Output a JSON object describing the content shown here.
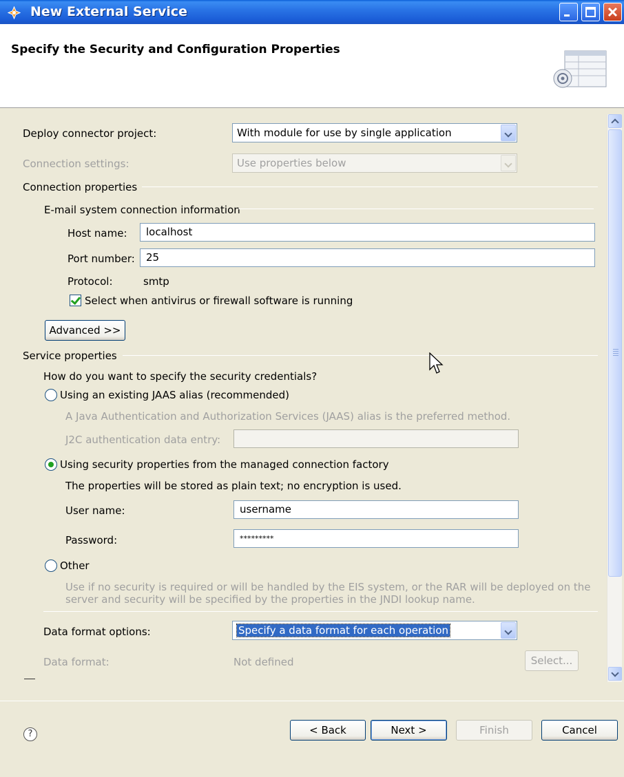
{
  "window": {
    "title": "New External Service"
  },
  "banner": {
    "title": "Specify the Security and Configuration Properties"
  },
  "deploy": {
    "label": "Deploy connector project:",
    "value": "With module for use by single application"
  },
  "connection_settings": {
    "label": "Connection settings:",
    "value": "Use properties below"
  },
  "connection_properties": {
    "title": "Connection properties",
    "email_group_title": "E-mail system connection information",
    "host_label": "Host name:",
    "host_value": "localhost",
    "port_label": "Port number:",
    "port_value": "25",
    "protocol_label": "Protocol:",
    "protocol_value": "smtp",
    "antivirus_label": "Select when antivirus or firewall software is running",
    "antivirus_checked": true,
    "advanced_button": "Advanced >>"
  },
  "service_properties": {
    "title": "Service properties",
    "question": "How do you want to specify the security credentials?",
    "jaas_option": "Using an existing JAAS alias (recommended)",
    "jaas_desc": "A Java Authentication and Authorization Services (JAAS) alias is the preferred method.",
    "j2c_label": "J2C authentication data entry:",
    "j2c_value": "",
    "mcf_option": "Using security properties from the managed connection factory",
    "mcf_desc": "The properties will be stored as plain text; no encryption is used.",
    "username_label": "User name:",
    "username_value": "username",
    "password_label": "Password:",
    "password_value": "*********",
    "other_option": "Other",
    "other_desc_line1": "Use if no security is required or will be handled by the EIS system, or the RAR will be deployed on the",
    "other_desc_line2": "server and security will be specified by the properties in the JNDI lookup name.",
    "selected_option": "mcf"
  },
  "data_format": {
    "options_label": "Data format options:",
    "options_value": "Specify a data format for each operation",
    "format_label": "Data format:",
    "format_value": "Not defined",
    "select_button": "Select..."
  },
  "footer": {
    "help_icon": "?",
    "back_button": "< Back",
    "next_button": "Next >",
    "finish_button": "Finish",
    "cancel_button": "Cancel"
  }
}
